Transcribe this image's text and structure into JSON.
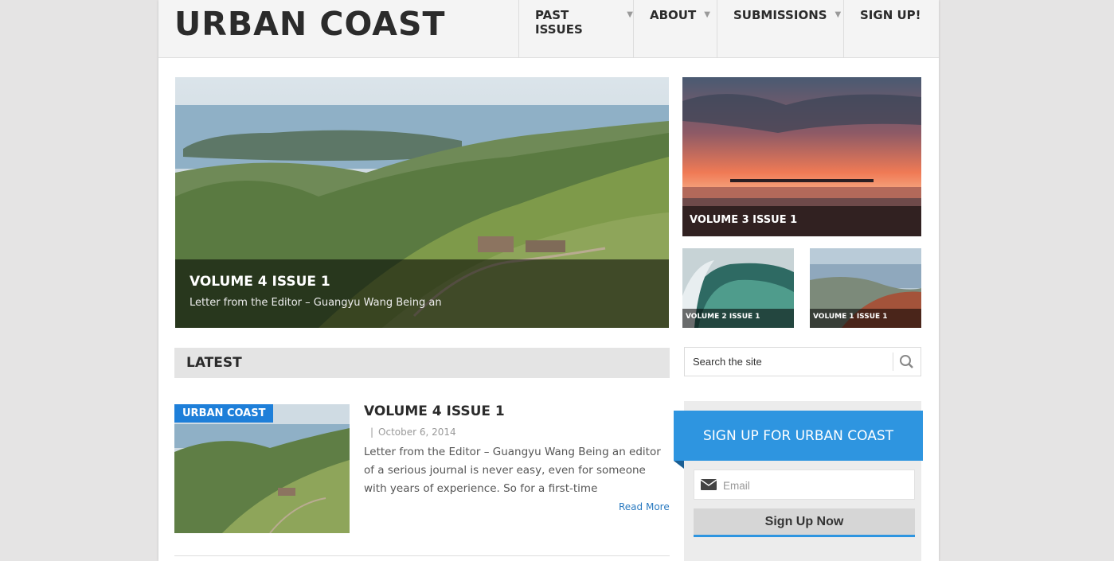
{
  "site": {
    "logo": "URBAN COAST"
  },
  "nav": [
    {
      "label": "PAST ISSUES",
      "has_dropdown": true
    },
    {
      "label": "ABOUT",
      "has_dropdown": true
    },
    {
      "label": "SUBMISSIONS",
      "has_dropdown": true
    },
    {
      "label": "SIGN UP!",
      "has_dropdown": false
    }
  ],
  "dropdown_icon": "triangle-down-icon",
  "featured": {
    "main": {
      "title": "VOLUME 4 ISSUE 1",
      "excerpt": "Letter from the Editor – Guangyu Wang Being an"
    },
    "v3": {
      "title": "VOLUME 3 ISSUE 1"
    },
    "v2": {
      "title": "VOLUME 2 ISSUE 1"
    },
    "v1": {
      "title": "VOLUME 1 ISSUE 1"
    }
  },
  "latest": {
    "heading": "LATEST",
    "post": {
      "category": "URBAN COAST",
      "title": "VOLUME 4 ISSUE 1",
      "date_separator": "|",
      "date": "October 6, 2014",
      "excerpt": "Letter from the Editor – Guangyu Wang Being an editor of a serious journal is never easy, even for someone with years of experience. So for a first-time",
      "read_more": "Read More"
    }
  },
  "search": {
    "placeholder": "Search the site",
    "icon": "search-icon"
  },
  "signup": {
    "heading": "SIGN UP FOR URBAN COAST",
    "email_placeholder": "Email",
    "email_icon": "envelope-icon",
    "button": "Sign Up Now"
  },
  "colors": {
    "accent": "#2e95e0",
    "badge": "#1e7fd9",
    "link": "#2a7ac0",
    "page_bg": "#e5e4e4"
  }
}
